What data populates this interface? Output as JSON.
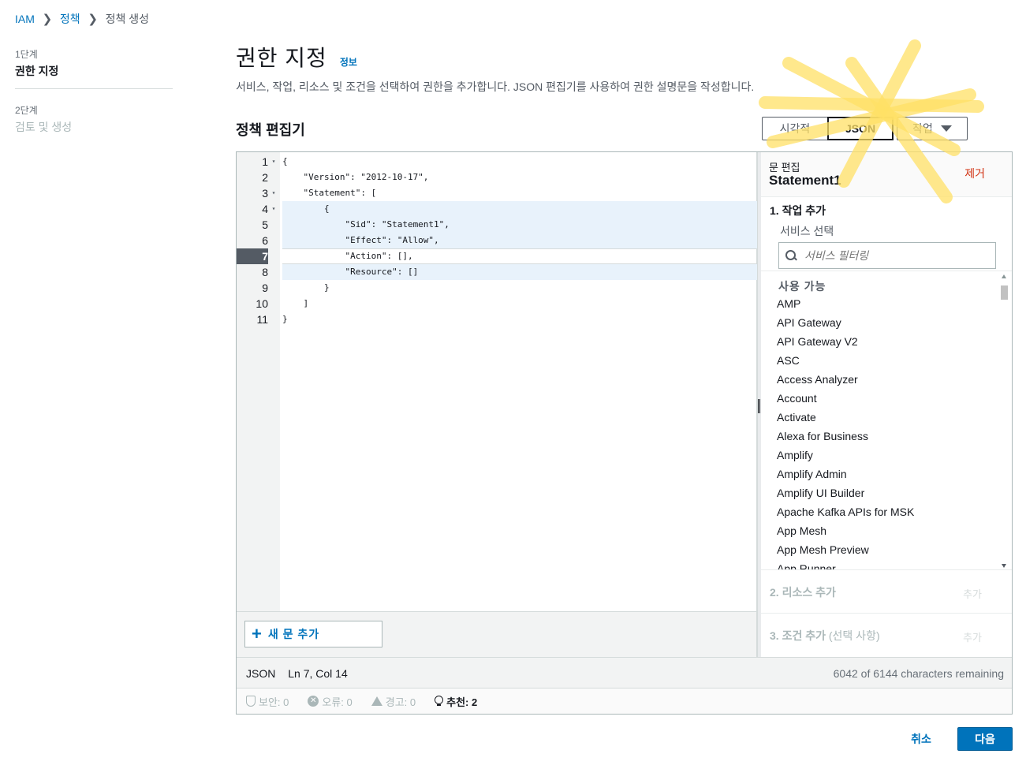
{
  "breadcrumb": {
    "items": [
      "IAM",
      "정책",
      "정책 생성"
    ]
  },
  "steps": [
    {
      "num": "1단계",
      "title": "권한 지정"
    },
    {
      "num": "2단계",
      "title": "검토 및 생성"
    }
  ],
  "header": {
    "title": "권한 지정",
    "info": "정보",
    "description": "서비스, 작업, 리소스 및 조건을 선택하여 권한을 추가합니다. JSON 편집기를 사용하여 권한 설명문을 작성합니다."
  },
  "editor": {
    "heading": "정책 편집기",
    "modes": {
      "visual": "시각적",
      "json": "JSON",
      "actions": "작업"
    },
    "code_lines": [
      "{",
      "    \"Version\": \"2012-10-17\",",
      "    \"Statement\": [",
      "        {",
      "            \"Sid\": \"Statement1\",",
      "            \"Effect\": \"Allow\",",
      "            \"Action\": [],",
      "            \"Resource\": []",
      "        }",
      "    ]",
      "}"
    ],
    "line_numbers": [
      "1",
      "2",
      "3",
      "4",
      "5",
      "6",
      "7",
      "8",
      "9",
      "10",
      "11"
    ],
    "active_line": 7,
    "add_statement": "새 문 추가"
  },
  "panel": {
    "sub_label": "문 편집",
    "statement_name": "Statement1",
    "remove": "제거",
    "section1": "1. 작업 추가",
    "select_service": "서비스 선택",
    "search_placeholder": "서비스 필터링",
    "available": "사용 가능",
    "services": [
      "AMP",
      "API Gateway",
      "API Gateway V2",
      "ASC",
      "Access Analyzer",
      "Account",
      "Activate",
      "Alexa for Business",
      "Amplify",
      "Amplify Admin",
      "Amplify UI Builder",
      "Apache Kafka APIs for MSK",
      "App Mesh",
      "App Mesh Preview",
      "App Runner"
    ],
    "section2": "2. 리소스 추가",
    "section2_add": "추가",
    "section3": "3. 조건 추가",
    "section3_optional": "(선택 사항)",
    "section3_add": "추가"
  },
  "status": {
    "mode": "JSON",
    "position": "Ln 7, Col 14",
    "remaining": "6042 of 6144 characters remaining"
  },
  "lint": {
    "security": "보안: 0",
    "errors": "오류: 0",
    "warnings": "경고: 0",
    "suggestions": "추천: 2"
  },
  "footer": {
    "cancel": "취소",
    "next": "다음"
  },
  "colors": {
    "accent": "#0073bb",
    "remove": "#d13212",
    "highlighter": "#ffe066"
  }
}
